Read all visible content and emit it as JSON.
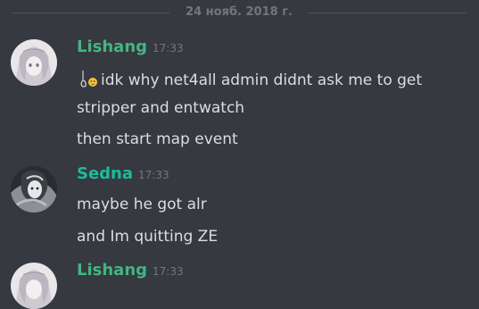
{
  "date_divider": "24 нояб. 2018 г.",
  "messages": [
    {
      "author": "Lishang",
      "author_color": "#43b581",
      "timestamp": "17:33",
      "lines": [
        "idk why net4all admin didnt ask me to get",
        "stripper and entwatch",
        "then start map event"
      ],
      "emoji_icons": [
        "sweat-drop-icon",
        "thinking-face-icon"
      ]
    },
    {
      "author": "Sedna",
      "author_color": "#1abc9c",
      "timestamp": "17:33",
      "lines": [
        "maybe he got alr",
        "and Im quitting ZE"
      ]
    },
    {
      "author": "Lishang",
      "author_color": "#43b581",
      "timestamp": "17:33",
      "lines": []
    }
  ],
  "colors": {
    "background": "#36393f",
    "text": "#dcddde",
    "muted": "#72767d",
    "divider": "#4f545c"
  }
}
